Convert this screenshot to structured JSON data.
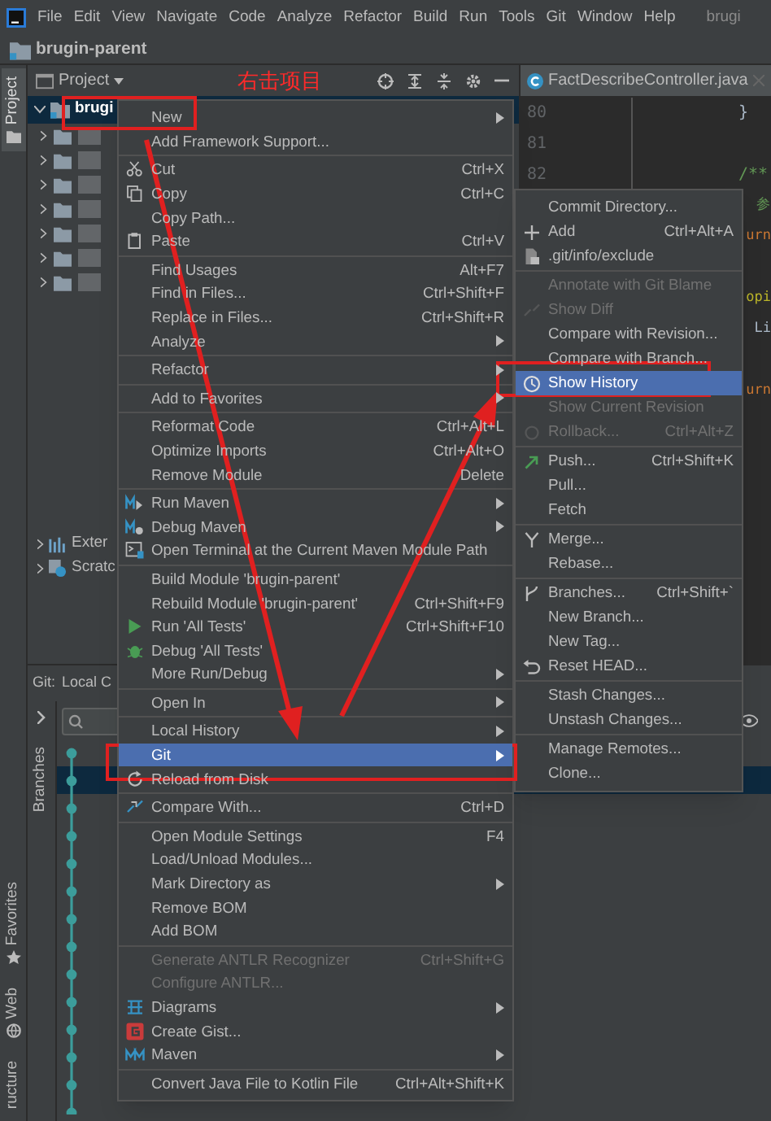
{
  "menu_bar": {
    "items": [
      "File",
      "Edit",
      "View",
      "Navigate",
      "Code",
      "Analyze",
      "Refactor",
      "Build",
      "Run",
      "Tools",
      "Git",
      "Window",
      "Help"
    ],
    "project_fragment": "brugi"
  },
  "breadcrumb": "brugin-parent",
  "left_strip": {
    "top": [
      {
        "label": "Project",
        "selected": true
      }
    ],
    "bottom": [
      {
        "label": "Favorites",
        "kind": "star",
        "selected": false
      },
      {
        "label": "Web",
        "kind": "globe",
        "selected": false
      },
      {
        "label": "ructure",
        "kind": "none",
        "selected": false
      }
    ]
  },
  "project_panel": {
    "title": "Project",
    "root": {
      "label": "brugi",
      "selected": true,
      "expanded": true
    },
    "others": [
      {
        "label": "Exter",
        "kind": "libraries"
      },
      {
        "label": "Scratc",
        "kind": "scratch"
      }
    ]
  },
  "editor": {
    "tab": "FactDescribeController.java",
    "lines": [
      {
        "number": "80",
        "code": "}",
        "kind": "plain"
      },
      {
        "number": "81"
      },
      {
        "number": "82",
        "code": "/**",
        "kind": "comment"
      },
      {
        "code": "参",
        "kind": "comment"
      },
      {
        "code": "urn",
        "kind": "keyword"
      },
      {
        "code": "opi",
        "kind": "annotation"
      },
      {
        "code": "Li",
        "kind": "plain"
      },
      {
        "code": "urn",
        "kind": "keyword"
      }
    ]
  },
  "git_panel": {
    "label": "Git:",
    "tab": "Local C",
    "side_label": "Branches"
  },
  "context_menu": {
    "groups": [
      [
        {
          "label": "New",
          "submenu": true
        },
        {
          "label": "Add Framework Support..."
        }
      ],
      [
        {
          "label": "Cut",
          "shortcut": "Ctrl+X"
        },
        {
          "label": "Copy",
          "shortcut": "Ctrl+C"
        },
        {
          "label": "Copy Path..."
        },
        {
          "label": "Paste",
          "shortcut": "Ctrl+V"
        }
      ],
      [
        {
          "label": "Find Usages",
          "shortcut": "Alt+F7"
        },
        {
          "label": "Find in Files...",
          "shortcut": "Ctrl+Shift+F"
        },
        {
          "label": "Replace in Files...",
          "shortcut": "Ctrl+Shift+R"
        },
        {
          "label": "Analyze",
          "submenu": true
        }
      ],
      [
        {
          "label": "Refactor",
          "submenu": true
        }
      ],
      [
        {
          "label": "Add to Favorites",
          "submenu": true
        }
      ],
      [
        {
          "label": "Reformat Code",
          "shortcut": "Ctrl+Alt+L"
        },
        {
          "label": "Optimize Imports",
          "shortcut": "Ctrl+Alt+O"
        },
        {
          "label": "Remove Module",
          "shortcut": "Delete"
        }
      ],
      [
        {
          "label": "Run Maven",
          "submenu": true
        },
        {
          "label": "Debug Maven",
          "submenu": true
        },
        {
          "label": "Open Terminal at the Current Maven Module Path"
        }
      ],
      [
        {
          "label": "Build Module 'brugin-parent'"
        },
        {
          "label": "Rebuild Module 'brugin-parent'",
          "shortcut": "Ctrl+Shift+F9"
        },
        {
          "label": "Run 'All Tests'",
          "shortcut": "Ctrl+Shift+F10"
        },
        {
          "label": "Debug 'All Tests'"
        },
        {
          "label": "More Run/Debug",
          "submenu": true
        }
      ],
      [
        {
          "label": "Open In",
          "submenu": true
        }
      ],
      [
        {
          "label": "Local History",
          "submenu": true
        },
        {
          "label": "Git",
          "submenu": true,
          "selected": true
        },
        {
          "label": "Reload from Disk"
        }
      ],
      [
        {
          "label": "Compare With...",
          "shortcut": "Ctrl+D"
        }
      ],
      [
        {
          "label": "Open Module Settings",
          "shortcut": "F4"
        },
        {
          "label": "Load/Unload Modules..."
        },
        {
          "label": "Mark Directory as",
          "submenu": true
        },
        {
          "label": "Remove BOM"
        },
        {
          "label": "Add BOM"
        }
      ],
      [
        {
          "label": "Generate ANTLR Recognizer",
          "shortcut": "Ctrl+Shift+G",
          "disabled": true
        },
        {
          "label": "Configure ANTLR...",
          "disabled": true
        },
        {
          "label": "Diagrams",
          "submenu": true
        },
        {
          "label": "Create Gist..."
        },
        {
          "label": "Maven",
          "submenu": true
        }
      ],
      [
        {
          "label": "Convert Java File to Kotlin File",
          "shortcut": "Ctrl+Alt+Shift+K"
        }
      ]
    ]
  },
  "git_submenu": {
    "groups": [
      [
        {
          "label": "Commit Directory..."
        },
        {
          "label": "Add",
          "shortcut": "Ctrl+Alt+A"
        },
        {
          "label": ".git/info/exclude"
        }
      ],
      [
        {
          "label": "Annotate with Git Blame",
          "disabled": true
        },
        {
          "label": "Show Diff",
          "disabled": true
        },
        {
          "label": "Compare with Revision..."
        },
        {
          "label": "Compare with Branch..."
        },
        {
          "label": "Show History",
          "selected": true
        },
        {
          "label": "Show Current Revision",
          "disabled": true
        },
        {
          "label": "Rollback...",
          "shortcut": "Ctrl+Alt+Z",
          "disabled": true
        }
      ],
      [
        {
          "label": "Push...",
          "shortcut": "Ctrl+Shift+K"
        },
        {
          "label": "Pull..."
        },
        {
          "label": "Fetch"
        }
      ],
      [
        {
          "label": "Merge..."
        },
        {
          "label": "Rebase..."
        }
      ],
      [
        {
          "label": "Branches...",
          "shortcut": "Ctrl+Shift+`"
        },
        {
          "label": "New Branch..."
        },
        {
          "label": "New Tag..."
        },
        {
          "label": "Reset HEAD..."
        }
      ],
      [
        {
          "label": "Stash Changes..."
        },
        {
          "label": "Unstash Changes..."
        }
      ],
      [
        {
          "label": "Manage Remotes..."
        },
        {
          "label": "Clone..."
        }
      ]
    ]
  },
  "annotation": {
    "caption": "右击项目"
  }
}
